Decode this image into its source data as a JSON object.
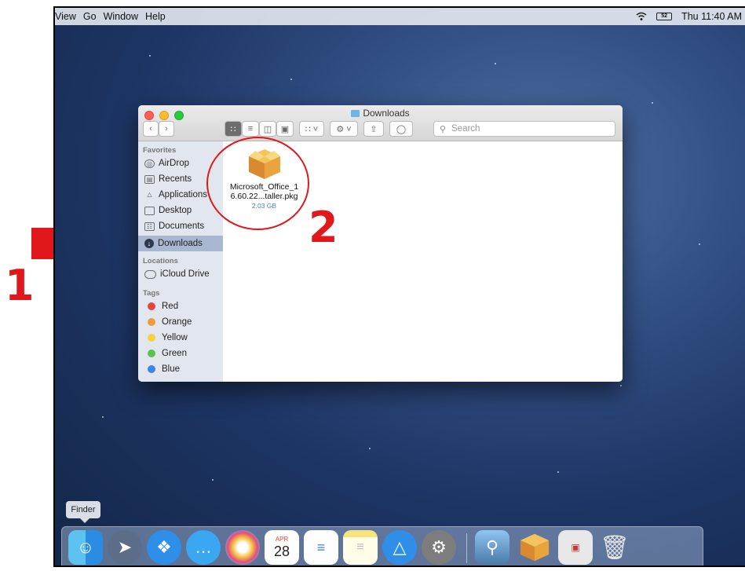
{
  "menubar": {
    "menus": [
      "View",
      "Go",
      "Window",
      "Help"
    ],
    "clock": "Thu 11:40 AM",
    "battery_label": "52"
  },
  "window": {
    "title": "Downloads",
    "search_placeholder": "Search"
  },
  "sidebar": {
    "favorites_header": "Favorites",
    "favorites": [
      "AirDrop",
      "Recents",
      "Applications",
      "Desktop",
      "Documents",
      "Downloads"
    ],
    "locations_header": "Locations",
    "locations": [
      "iCloud Drive"
    ],
    "tags_header": "Tags",
    "tags": [
      {
        "label": "Red",
        "color": "#e5453e"
      },
      {
        "label": "Orange",
        "color": "#f19a38"
      },
      {
        "label": "Yellow",
        "color": "#f5d33c"
      },
      {
        "label": "Green",
        "color": "#5ac34f"
      },
      {
        "label": "Blue",
        "color": "#3b86e8"
      }
    ]
  },
  "file": {
    "name_line1": "Microsoft_Office_1",
    "name_line2": "6.60.22...taller.pkg",
    "size": "2.03 GB"
  },
  "annotations": {
    "step1": "1",
    "step2": "2",
    "accent": "#e0181c"
  },
  "dock": {
    "tooltip": "Finder",
    "calendar_month": "APR",
    "calendar_day": "28"
  }
}
